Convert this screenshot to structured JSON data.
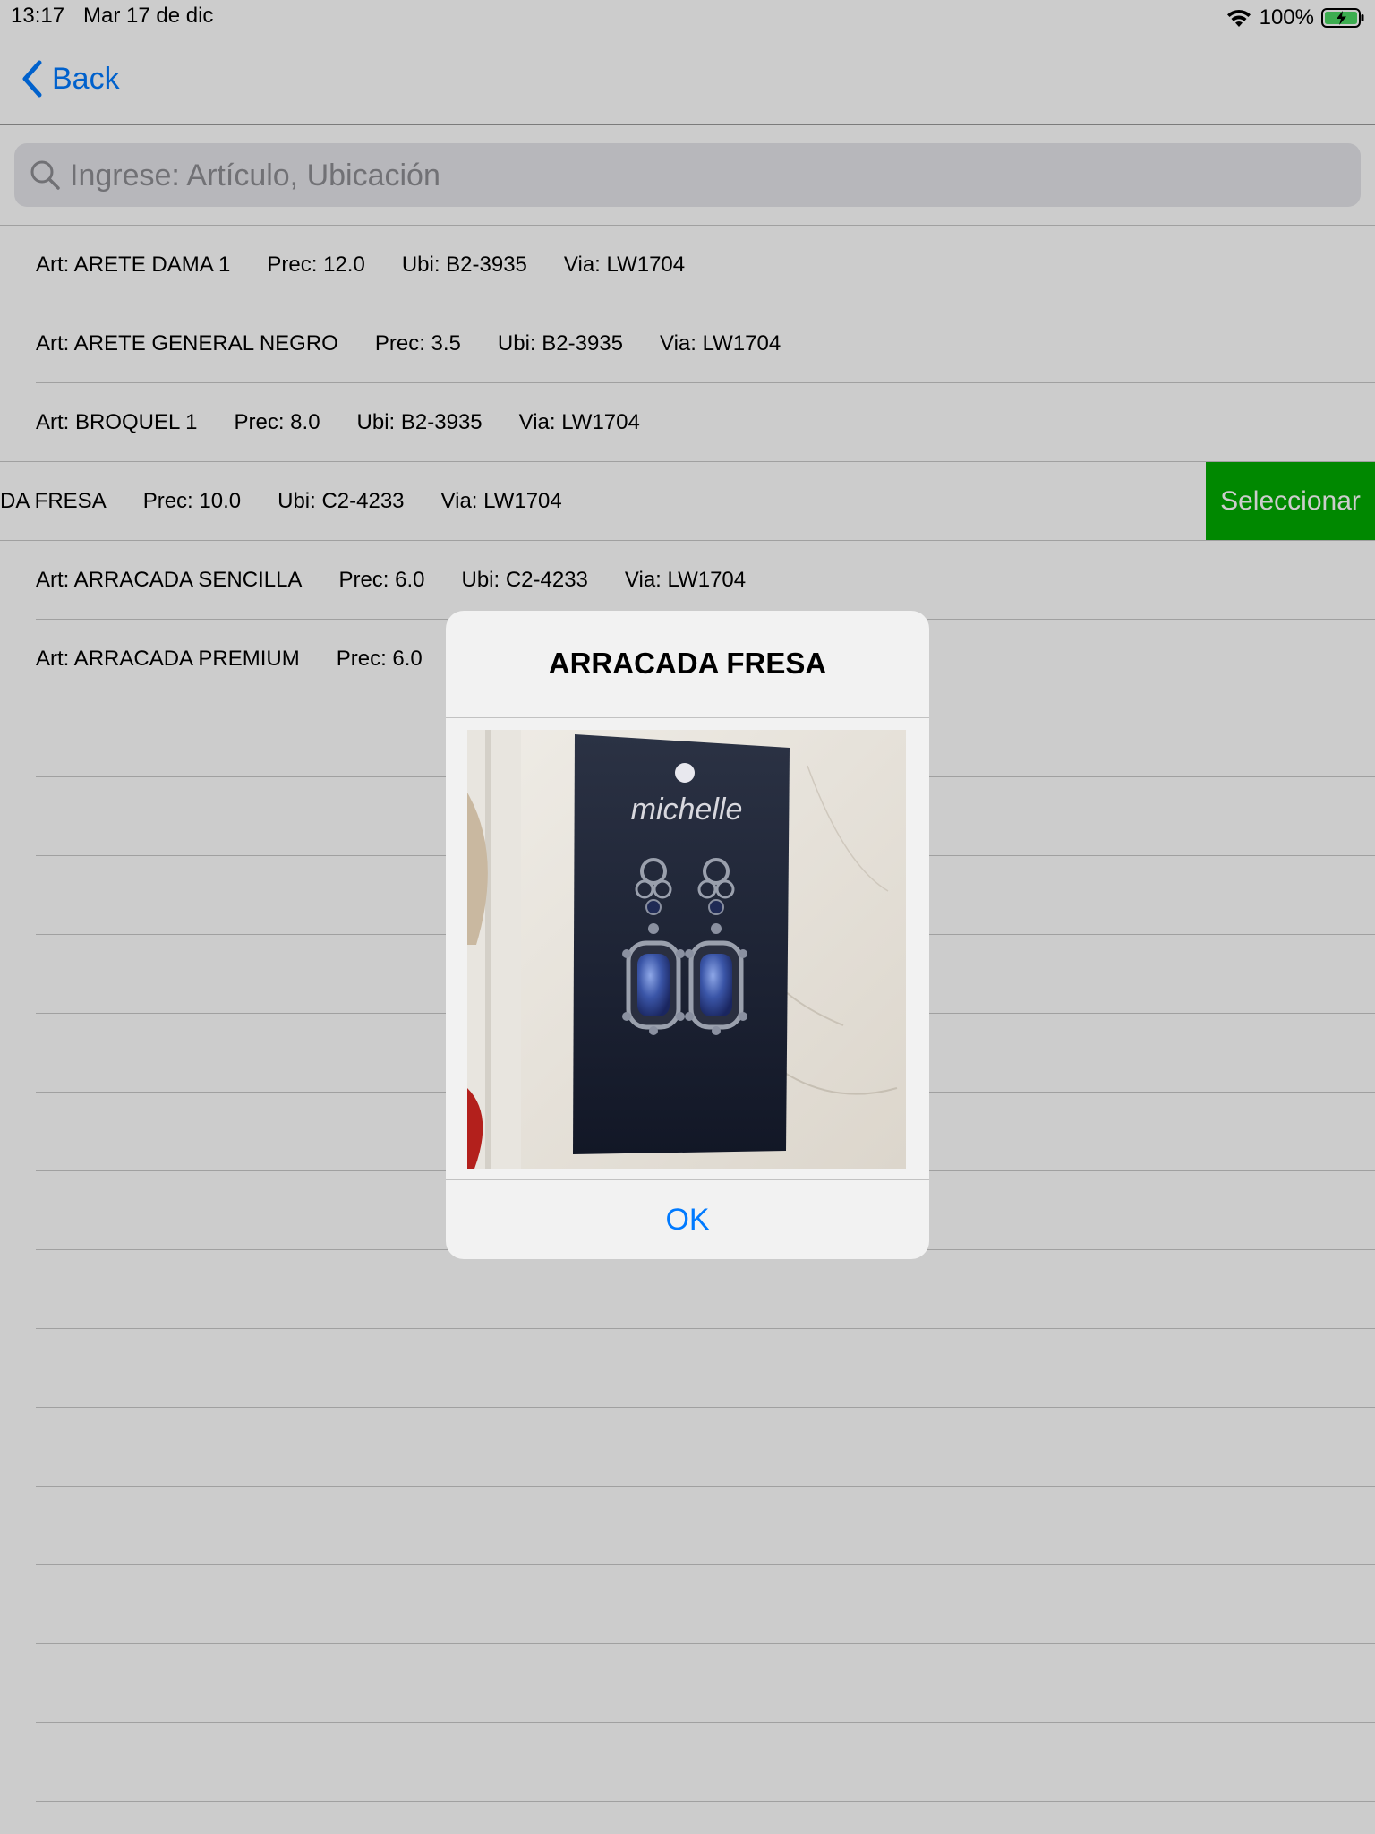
{
  "status_bar": {
    "time": "13:17",
    "date": "Mar 17 de dic",
    "battery": "100%",
    "wifi_icon": "wifi-icon",
    "battery_icon": "battery-charging-icon"
  },
  "nav": {
    "back_label": "Back",
    "back_icon": "chevron-left-icon",
    "accent_color": "#007aff"
  },
  "search": {
    "placeholder": "Ingrese: Artículo, Ubicación",
    "value": "",
    "icon": "search-icon"
  },
  "rows": [
    {
      "art": "Art: ARETE DAMA 1",
      "prec": "Prec: 12.0",
      "ubi": "Ubi: B2-3935",
      "via": "Via: LW1704"
    },
    {
      "art": "Art: ARETE GENERAL NEGRO",
      "prec": "Prec: 3.5",
      "ubi": "Ubi: B2-3935",
      "via": "Via: LW1704"
    },
    {
      "art": "Art: BROQUEL 1",
      "prec": "Prec: 8.0",
      "ubi": "Ubi: B2-3935",
      "via": "Via: LW1704"
    },
    {
      "art": "DA FRESA",
      "prec": "Prec: 10.0",
      "ubi": "Ubi: C2-4233",
      "via": "Via: LW1704",
      "action": "Seleccionar",
      "action_color": "#00aa00"
    },
    {
      "art": "Art: ARRACADA SENCILLA",
      "prec": "Prec: 6.0",
      "ubi": "Ubi: C2-4233",
      "via": "Via: LW1704"
    },
    {
      "art": "Art: ARRACADA PREMIUM",
      "prec": "Prec: 6.0"
    }
  ],
  "alert": {
    "title": "ARRACADA FRESA",
    "ok_label": "OK",
    "image_brand_text": "michelle"
  }
}
